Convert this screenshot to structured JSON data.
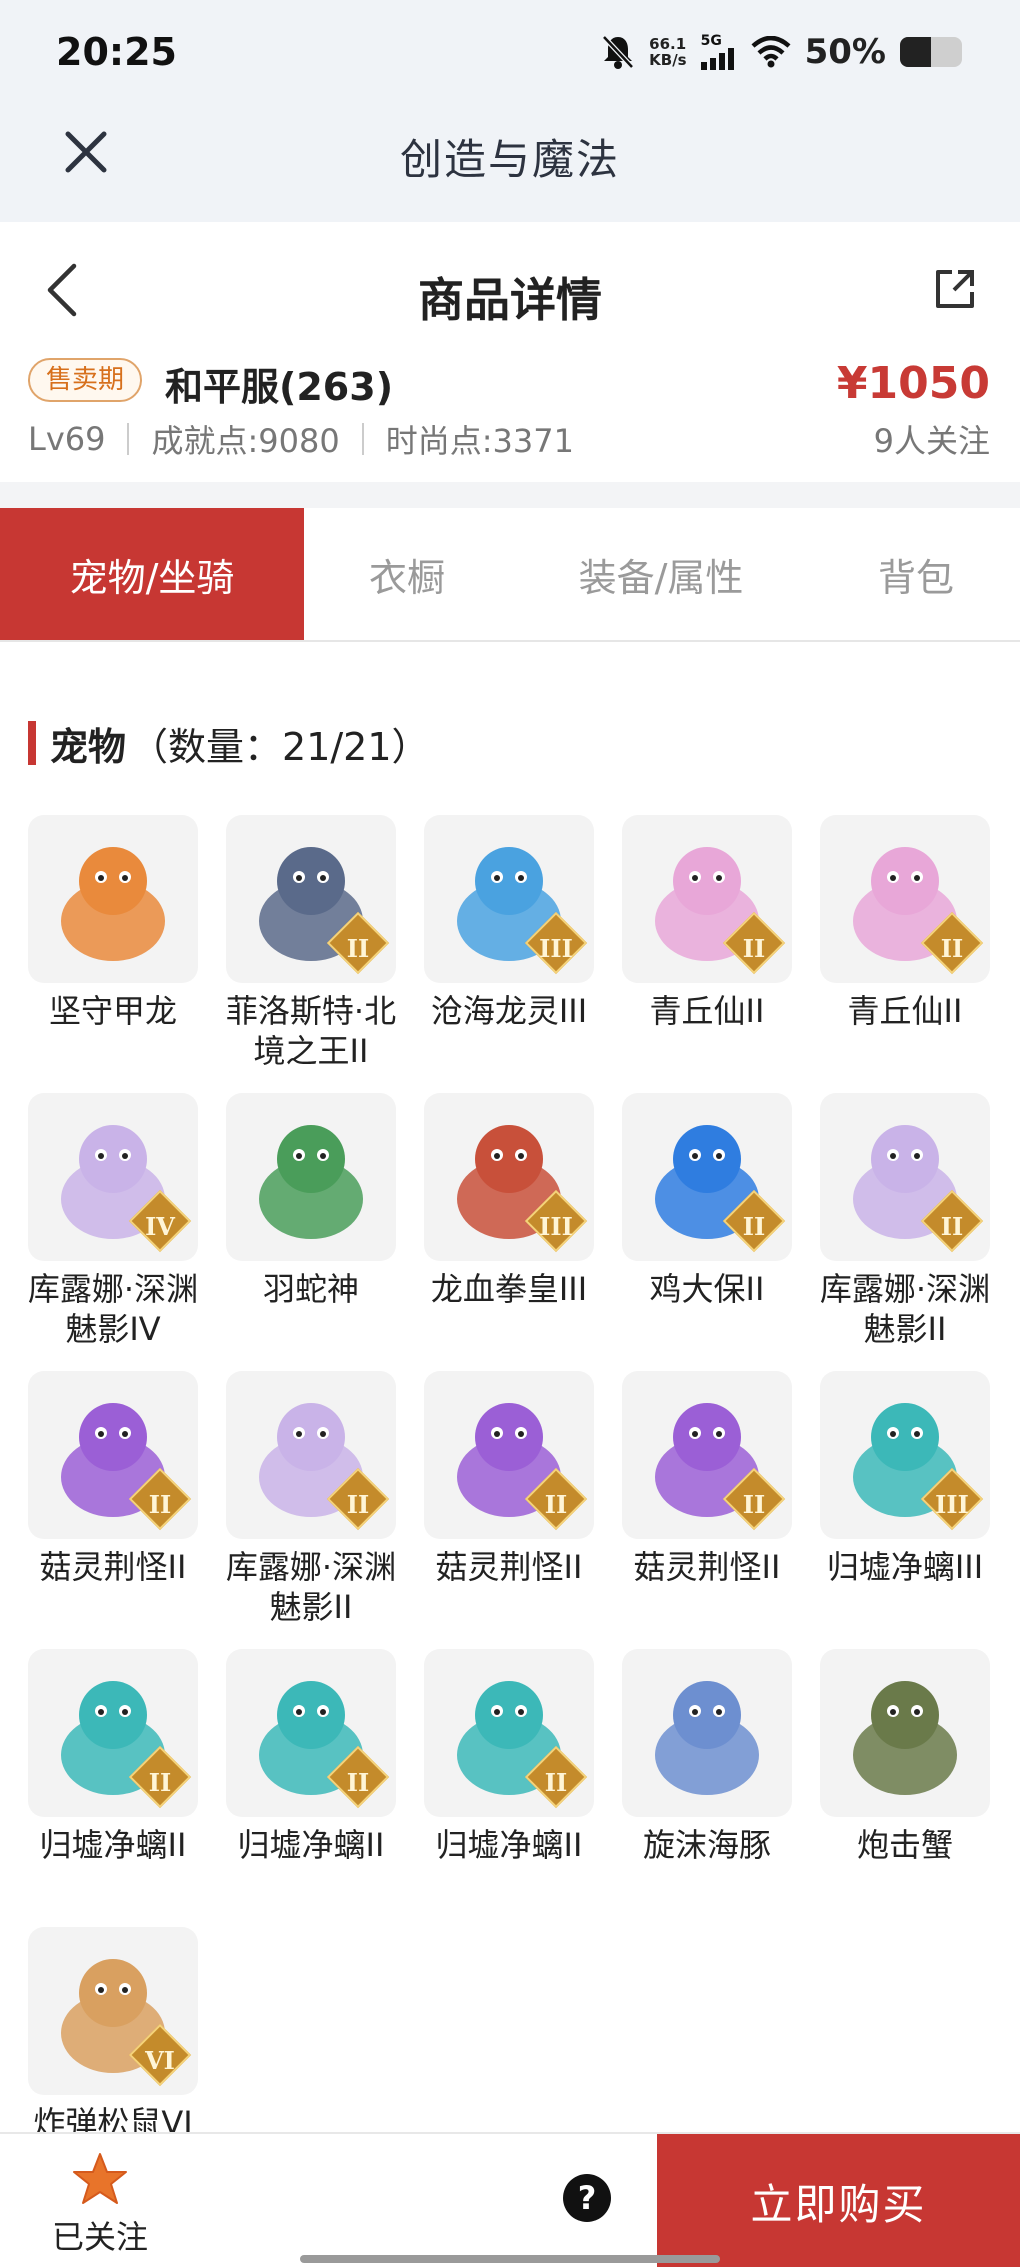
{
  "status": {
    "time": "20:25",
    "net_speed_value": "66.1",
    "net_speed_unit": "KB/s",
    "network": "5G",
    "battery_percent": "50%",
    "battery_level": 0.5,
    "icons": [
      "bell-muted-icon",
      "signal-icon",
      "wifi-icon",
      "battery-icon"
    ]
  },
  "appbar": {
    "title": "创造与魔法",
    "close_icon": "close-icon"
  },
  "detail": {
    "title": "商品详情",
    "back_icon": "back-icon",
    "share_icon": "share-icon"
  },
  "product": {
    "badge": "售卖期",
    "server": "和平服(263)",
    "price": "¥1050",
    "level": "Lv69",
    "achievement": "成就点:9080",
    "fashion": "时尚点:3371",
    "followers": "9人关注"
  },
  "tabs": [
    {
      "label": "宠物/坐骑",
      "active": true
    },
    {
      "label": "衣橱",
      "active": false
    },
    {
      "label": "装备/属性",
      "active": false
    },
    {
      "label": "背包",
      "active": false
    }
  ],
  "section": {
    "title": "宠物",
    "count": "（数量：21/21）"
  },
  "pets": [
    {
      "name": "坚守甲龙",
      "grade": "",
      "color": "#e98a3c"
    },
    {
      "name": "菲洛斯特·北境之王II",
      "grade": "II",
      "color": "#5a6a8a"
    },
    {
      "name": "沧海龙灵III",
      "grade": "III",
      "color": "#4aa2e0"
    },
    {
      "name": "青丘仙II",
      "grade": "II",
      "color": "#e8a7d8"
    },
    {
      "name": "青丘仙II",
      "grade": "II",
      "color": "#e8a7d8"
    },
    {
      "name": "库露娜·深渊魅影IV",
      "grade": "IV",
      "color": "#c9b3e8"
    },
    {
      "name": "羽蛇神",
      "grade": "",
      "color": "#4a9d5a"
    },
    {
      "name": "龙血拳皇III",
      "grade": "III",
      "color": "#c8503a"
    },
    {
      "name": "鸡大保II",
      "grade": "II",
      "color": "#2f7de0"
    },
    {
      "name": "库露娜·深渊魅影II",
      "grade": "II",
      "color": "#c9b3e8"
    },
    {
      "name": "菇灵荆怪II",
      "grade": "II",
      "color": "#9b5fd6"
    },
    {
      "name": "库露娜·深渊魅影II",
      "grade": "II",
      "color": "#c9b3e8"
    },
    {
      "name": "菇灵荆怪II",
      "grade": "II",
      "color": "#9b5fd6"
    },
    {
      "name": "菇灵荆怪II",
      "grade": "II",
      "color": "#9b5fd6"
    },
    {
      "name": "归墟净螭III",
      "grade": "III",
      "color": "#3cb8b8"
    },
    {
      "name": "归墟净螭II",
      "grade": "II",
      "color": "#3cb8b8"
    },
    {
      "name": "归墟净螭II",
      "grade": "II",
      "color": "#3cb8b8"
    },
    {
      "name": "归墟净螭II",
      "grade": "II",
      "color": "#3cb8b8"
    },
    {
      "name": "旋沫海豚",
      "grade": "",
      "color": "#6d8fd0"
    },
    {
      "name": "炮击蟹",
      "grade": "",
      "color": "#6a7a4a"
    },
    {
      "name": "炸弹松鼠VI",
      "grade": "VI",
      "color": "#d9a060"
    }
  ],
  "bottom": {
    "follow_label": "已关注",
    "follow_icon": "star-icon",
    "help_icon": "?",
    "buy_label": "立即购买"
  },
  "colors": {
    "accent": "#c73733",
    "price": "#c83a35",
    "badge": "#d7701c"
  }
}
